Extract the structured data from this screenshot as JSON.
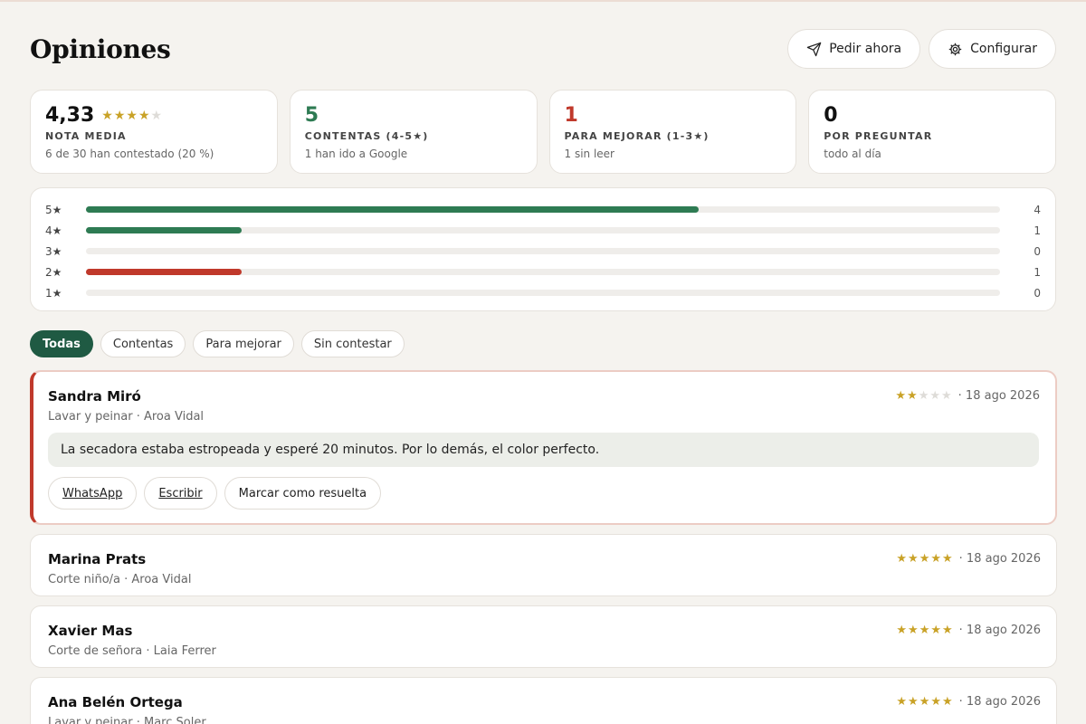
{
  "header": {
    "title": "Opiniones",
    "order_label": "Pedir ahora",
    "settings_label": "Configurar"
  },
  "stats": [
    {
      "value": "4,33",
      "label": "NOTA MEDIA",
      "sub": "6 de 30 han contestado (20 %)",
      "rating": 4,
      "tone": "dark"
    },
    {
      "value": "5",
      "label": "CONTENTAS (4-5★)",
      "sub": "1 han ido a Google",
      "tone": "green"
    },
    {
      "value": "1",
      "label": "PARA MEJORAR (1-3★)",
      "sub": "1 sin leer",
      "tone": "red"
    },
    {
      "value": "0",
      "label": "POR PREGUNTAR",
      "sub": "todo al día",
      "tone": "dark"
    }
  ],
  "distribution": [
    {
      "label": "5★",
      "count": "4",
      "fraction": 0.67,
      "color": "#2e7b53"
    },
    {
      "label": "4★",
      "count": "1",
      "fraction": 0.17,
      "color": "#2e7b53"
    },
    {
      "label": "3★",
      "count": "0",
      "fraction": 0,
      "color": "#2e7b53"
    },
    {
      "label": "2★",
      "count": "1",
      "fraction": 0.17,
      "color": "#c0392b"
    },
    {
      "label": "1★",
      "count": "0",
      "fraction": 0,
      "color": "#c0392b"
    }
  ],
  "filters": [
    {
      "label": "Todas",
      "active": true
    },
    {
      "label": "Contentas",
      "active": false
    },
    {
      "label": "Para mejorar",
      "active": false
    },
    {
      "label": "Sin contestar",
      "active": false
    }
  ],
  "reviews": [
    {
      "name": "Sandra Miró",
      "meta": "Lavar y peinar · Aroa Vidal",
      "rating": 2,
      "date": "· 18 ago 2026",
      "text": "La secadora estaba estropeada y esperé 20 minutos. Por lo demás, el color perfecto.",
      "flag": true,
      "actions": [
        "WhatsApp",
        "Escribir",
        "Marcar como resuelta"
      ]
    },
    {
      "name": "Marina Prats",
      "meta": "Corte niño/a · Aroa Vidal",
      "rating": 5,
      "date": "· 18 ago 2026"
    },
    {
      "name": "Xavier Mas",
      "meta": "Corte de señora · Laia Ferrer",
      "rating": 5,
      "date": "· 18 ago 2026"
    },
    {
      "name": "Ana Belén Ortega",
      "meta": "Lavar y peinar · Marc Soler",
      "rating": 5,
      "date": "· 18 ago 2026"
    }
  ],
  "colors": {
    "accent": "#1f5a43",
    "positive": "#2e7b53",
    "negative": "#c0392b",
    "star": "#c9a227"
  }
}
